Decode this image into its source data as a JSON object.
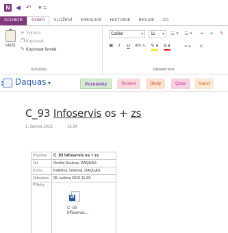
{
  "qat": {
    "app_icon": "N",
    "back_glyph": "◀",
    "undo_glyph": "↶",
    "more_glyph": "▾ ="
  },
  "ribbon_tabs": [
    "SOUBOR",
    "DOMŮ",
    "VLOŽENÍ",
    "KRESLENÍ",
    "HISTORIE",
    "REVIZE",
    "ZO"
  ],
  "clipboard": {
    "paste_label": "Vložit",
    "cut_label": "Vyjmout",
    "copy_label": "Kopírovat",
    "format_label": "Kopírovat formát",
    "group_label": "Schránka"
  },
  "basic_text": {
    "font": "Calibri",
    "size": "11",
    "group_label": "Základní text",
    "bold": "B",
    "italic": "I",
    "underline": "U",
    "strike": "abc x,",
    "highlight_color": "#f2e600",
    "font_color": "#e31d1d"
  },
  "notebook": {
    "name": "Daquas",
    "sections": [
      "Poznámky",
      "Školení",
      "Úkoly",
      "Quas",
      "Kancl"
    ]
  },
  "page": {
    "title_prefix": "C_93 ",
    "title_link": "Infoservis",
    "title_rest": " os + ",
    "title_link2": "zs",
    "date": "1. června 2015",
    "time": "16:34"
  },
  "email": {
    "rows": [
      {
        "key": "Předmět",
        "value": "C_93 Infoservis os + zs"
      },
      {
        "key": "Od",
        "value": "Ondřej Soukup, DAQUAS"
      },
      {
        "key": "Komu",
        "value": "Kateřina Srbková, DAQUAS"
      },
      {
        "key": "Odesláno",
        "value": "25. května 2015 11:33"
      },
      {
        "key": "Přílohy",
        "value": ""
      }
    ],
    "attachment_name": "C_93 Infoservis..."
  },
  "colors": {
    "accent": "#80397b",
    "notebook_blue": "#2a5aa6"
  }
}
